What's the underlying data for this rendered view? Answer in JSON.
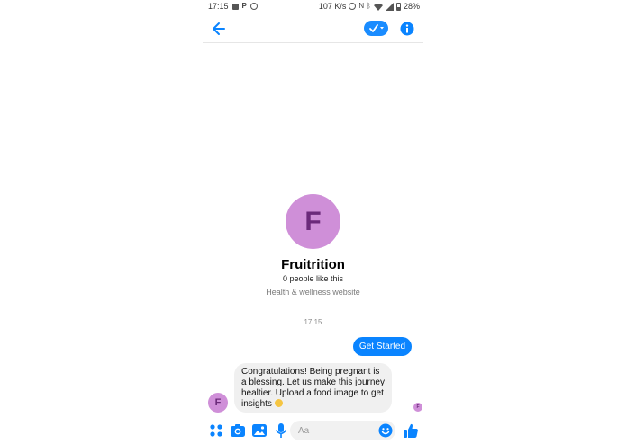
{
  "status_bar": {
    "time": "17:15",
    "left_icons": [
      "image-icon",
      "p-app-icon",
      "messenger-icon"
    ],
    "speed": "107 K/s",
    "right_icons": [
      "alarm-icon",
      "nfc-icon",
      "bluetooth-icon",
      "wifi-icon",
      "signal-icon",
      "battery-icon"
    ],
    "battery": "28%"
  },
  "header": {
    "back_icon": "arrow-left-icon",
    "check_icon": "check-dropdown-icon",
    "info_icon": "info-icon"
  },
  "profile": {
    "avatar_letter": "F",
    "name": "Fruitrition",
    "likes": "0 people like this",
    "category": "Health & wellness website"
  },
  "conversation": {
    "timestamp": "17:15",
    "user_message": "Get Started",
    "bot_message": "Congratulations! Being pregnant is a blessing. Let us make this journey healtier. Upload a food image to get insights",
    "bot_avatar_letter": "F",
    "seen_avatar_letter": "F"
  },
  "composer": {
    "placeholder": "Aa",
    "icons": [
      "apps-icon",
      "camera-icon",
      "gallery-icon",
      "microphone-icon",
      "emoji-icon",
      "thumbs-up-icon"
    ]
  },
  "colors": {
    "accent": "#0a84ff",
    "avatar_bg": "#cf8fd8",
    "avatar_text": "#6b2a7a"
  }
}
